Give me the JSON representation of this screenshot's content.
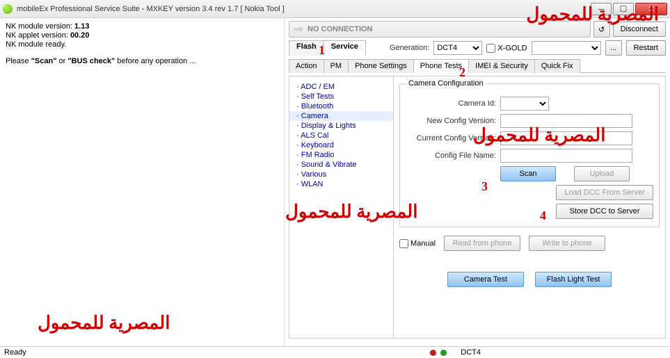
{
  "title": "mobileEx Professional Service Suite - MXKEY version 3.4 rev 1.7  [ Nokia Tool ]",
  "left": {
    "l1a": "NK module version: ",
    "l1b": "1.13",
    "l2a": "NK applet version: ",
    "l2b": "00.20",
    "l3": "NK module ready.",
    "l4a": "Please ",
    "l4b": "\"Scan\"",
    "l4c": " or ",
    "l4d": "\"BUS check\"",
    "l4e": " before any operation ..."
  },
  "conn": {
    "text": "NO CONNECTION",
    "disconnect": "Disconnect"
  },
  "row2": {
    "flash": "Flash",
    "service": "Service",
    "genlabel": "Generation:",
    "gen": "DCT4",
    "xgold": "X-GOLD",
    "dots": "...",
    "restart": "Restart"
  },
  "tabs": {
    "action": "Action",
    "pm": "PM",
    "phoneset": "Phone Settings",
    "phonetests": "Phone Tests",
    "imei": "IMEI & Security",
    "quick": "Quick Fix"
  },
  "tests": [
    "ADC / EM",
    "Self Tests",
    "Bluetooth",
    "Camera",
    "Display & Lights",
    "ALS Cal",
    "Keyboard",
    "FM Radio",
    "Sound & Vibrate",
    "Various",
    "WLAN"
  ],
  "cam": {
    "legend": "Camera Configuration",
    "camid": "Camera Id:",
    "newcfg": "New Config Version:",
    "curcfg": "Current Config Version:",
    "file": "Config File Name:",
    "scan": "Scan",
    "upload": "Upload",
    "loaddcc": "Load DCC From Server",
    "storedcc": "Store DCC to Server",
    "manual": "Manual",
    "read": "Read from phone",
    "write": "Write to phone",
    "camtest": "Camera Test",
    "flashtest": "Flash Light Test"
  },
  "status": {
    "ready": "Ready",
    "gen": "DCT4"
  },
  "wm": "المصرية للمحمول",
  "an": {
    "a1": "1",
    "a2": "2",
    "a3": "3",
    "a4": "4"
  }
}
